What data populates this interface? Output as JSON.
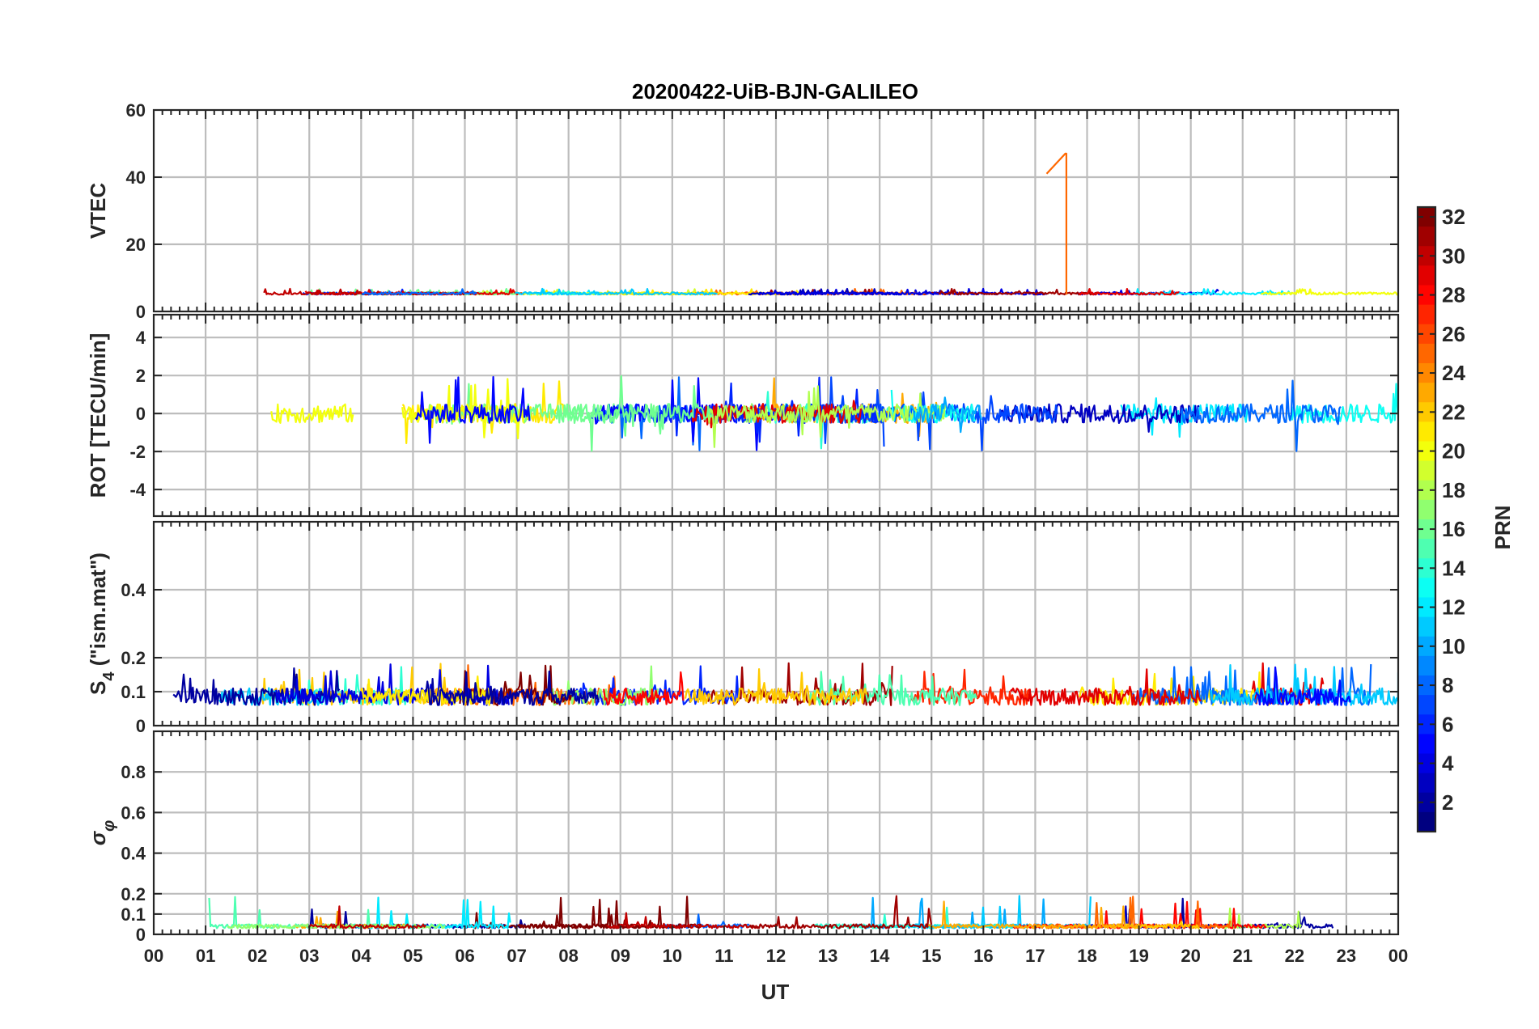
{
  "chart_data": {
    "type": "line",
    "title": "20200422-UiB-BJN-GALILEO",
    "xlabel": "UT",
    "x_tick_labels": [
      "00",
      "01",
      "02",
      "03",
      "04",
      "05",
      "06",
      "07",
      "08",
      "09",
      "10",
      "11",
      "12",
      "13",
      "14",
      "15",
      "16",
      "17",
      "18",
      "19",
      "20",
      "21",
      "22",
      "23",
      "00"
    ],
    "xlim_hours": [
      0,
      24
    ],
    "grid": true,
    "colormap": "jet",
    "colorbar": {
      "label": "PRN",
      "range": [
        1,
        32
      ],
      "ticks": [
        "32",
        "30",
        "28",
        "26",
        "24",
        "22",
        "20",
        "18",
        "16",
        "14",
        "12",
        "10",
        "8",
        "6",
        "4",
        "2"
      ],
      "tick_values": [
        32,
        30,
        28,
        26,
        24,
        22,
        20,
        18,
        16,
        14,
        12,
        10,
        8,
        6,
        4,
        2
      ]
    },
    "panels": [
      {
        "ylabel": "VTEC",
        "ylim": [
          0,
          60
        ],
        "ytick_values": [
          0,
          20,
          40,
          60
        ],
        "ytick_labels": [
          "0",
          "20",
          "40",
          "60"
        ],
        "baseline": 5,
        "noise": 0.7,
        "spike": {
          "t": 17.6,
          "peak": 47,
          "prn": 25
        }
      },
      {
        "ylabel": "ROT [TECU/min]",
        "ylim": [
          -5.4,
          5.2
        ],
        "ytick_values": [
          -4,
          -2,
          0,
          2,
          4
        ],
        "ytick_labels": [
          "-4",
          "-2",
          "0",
          "2",
          "4"
        ],
        "baseline": 0,
        "noise": 0.5
      },
      {
        "ylabel": "S4 (\"ism.mat\")",
        "ylabel_main": "S",
        "ylabel_sub": "4",
        "ylabel_rest": " (\"ism.mat\")",
        "ylim": [
          0,
          0.6
        ],
        "ytick_values": [
          0,
          0.1,
          0.2,
          0.4
        ],
        "ytick_labels": [
          "0",
          "0.1",
          "0.2",
          "0.4"
        ],
        "baseline": 0.06,
        "noise": 0.05
      },
      {
        "ylabel": "σφ",
        "ylabel_main": "σ",
        "ylabel_sub": "φ",
        "ylim": [
          0,
          1.0
        ],
        "ytick_values": [
          0,
          0.1,
          0.2,
          0.4,
          0.6,
          0.8
        ],
        "ytick_labels": [
          "0",
          "0.1",
          "0.2",
          "0.4",
          "0.6",
          "0.8"
        ],
        "baseline": 0.03,
        "noise": 0.02
      }
    ]
  }
}
